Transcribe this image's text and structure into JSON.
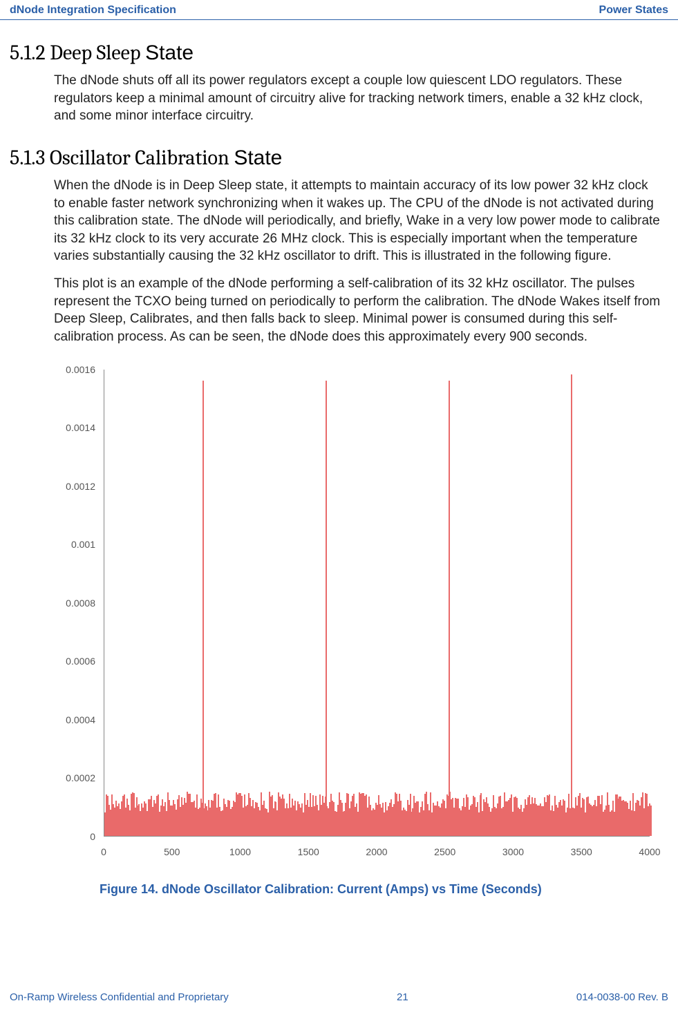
{
  "header": {
    "left": "dNode Integration Specification",
    "right": "Power States"
  },
  "sections": {
    "s512": {
      "number": "5.1.2",
      "title_serif": "Deep Sleep",
      "title_sans": "State",
      "paragraphs": [
        "The dNode shuts off all its power regulators except a couple low quiescent LDO regulators. These regulators keep a minimal amount of circuitry alive for tracking network timers, enable a 32 kHz clock, and some minor interface circuitry."
      ]
    },
    "s513": {
      "number": "5.1.3",
      "title_serif": "Oscillator Calibration",
      "title_sans": "State",
      "paragraphs": [
        "When the dNode is in Deep Sleep state, it attempts to maintain accuracy of its low power 32 kHz clock to enable faster network synchronizing when it wakes up. The CPU of the dNode is not activated during this calibration state. The dNode will periodically, and briefly, Wake in a very low power mode to calibrate its 32 kHz clock to its very accurate 26 MHz clock. This is especially important when the temperature varies substantially causing the 32 kHz oscillator to drift. This is illustrated in the following figure.",
        "This plot is an example of the dNode performing a self-calibration of its 32 kHz oscillator. The pulses represent the TCXO being turned on periodically to perform the calibration. The dNode Wakes itself from Deep Sleep, Calibrates, and then falls back to sleep. Minimal power is consumed during this self-calibration process. As can be seen, the dNode does this approximately every 900 seconds."
      ]
    }
  },
  "figure_caption": "Figure 14. dNode Oscillator Calibration: Current (Amps) vs Time (Seconds)",
  "footer": {
    "left": "On-Ramp Wireless Confidential and Proprietary",
    "center": "21",
    "right": "014-0038-00 Rev. B"
  },
  "chart_data": {
    "type": "line",
    "title": "",
    "xlabel": "Time (Seconds)",
    "ylabel": "Current (Amps)",
    "xlim": [
      0,
      4000
    ],
    "ylim": [
      0,
      0.0016
    ],
    "x_ticks": [
      0,
      500,
      1000,
      1500,
      2000,
      2500,
      3000,
      3500,
      4000
    ],
    "y_ticks": [
      0,
      0.0002,
      0.0004,
      0.0006,
      0.0008,
      0.001,
      0.0012,
      0.0014,
      0.0016
    ],
    "y_tick_labels": [
      "0",
      "0.0002",
      "0.0004",
      "0.0006",
      "0.0008",
      "0.001",
      "0.0012",
      "0.0014",
      "0.0016"
    ],
    "baseline_current": 8e-05,
    "baseline_noise_peak": 0.00015,
    "spikes": [
      {
        "x": 720,
        "y": 0.00156
      },
      {
        "x": 1620,
        "y": 0.00156
      },
      {
        "x": 2520,
        "y": 0.00156
      },
      {
        "x": 3420,
        "y": 0.00158
      }
    ],
    "spike_interval_seconds": 900,
    "series_color": "#e96a6a"
  }
}
